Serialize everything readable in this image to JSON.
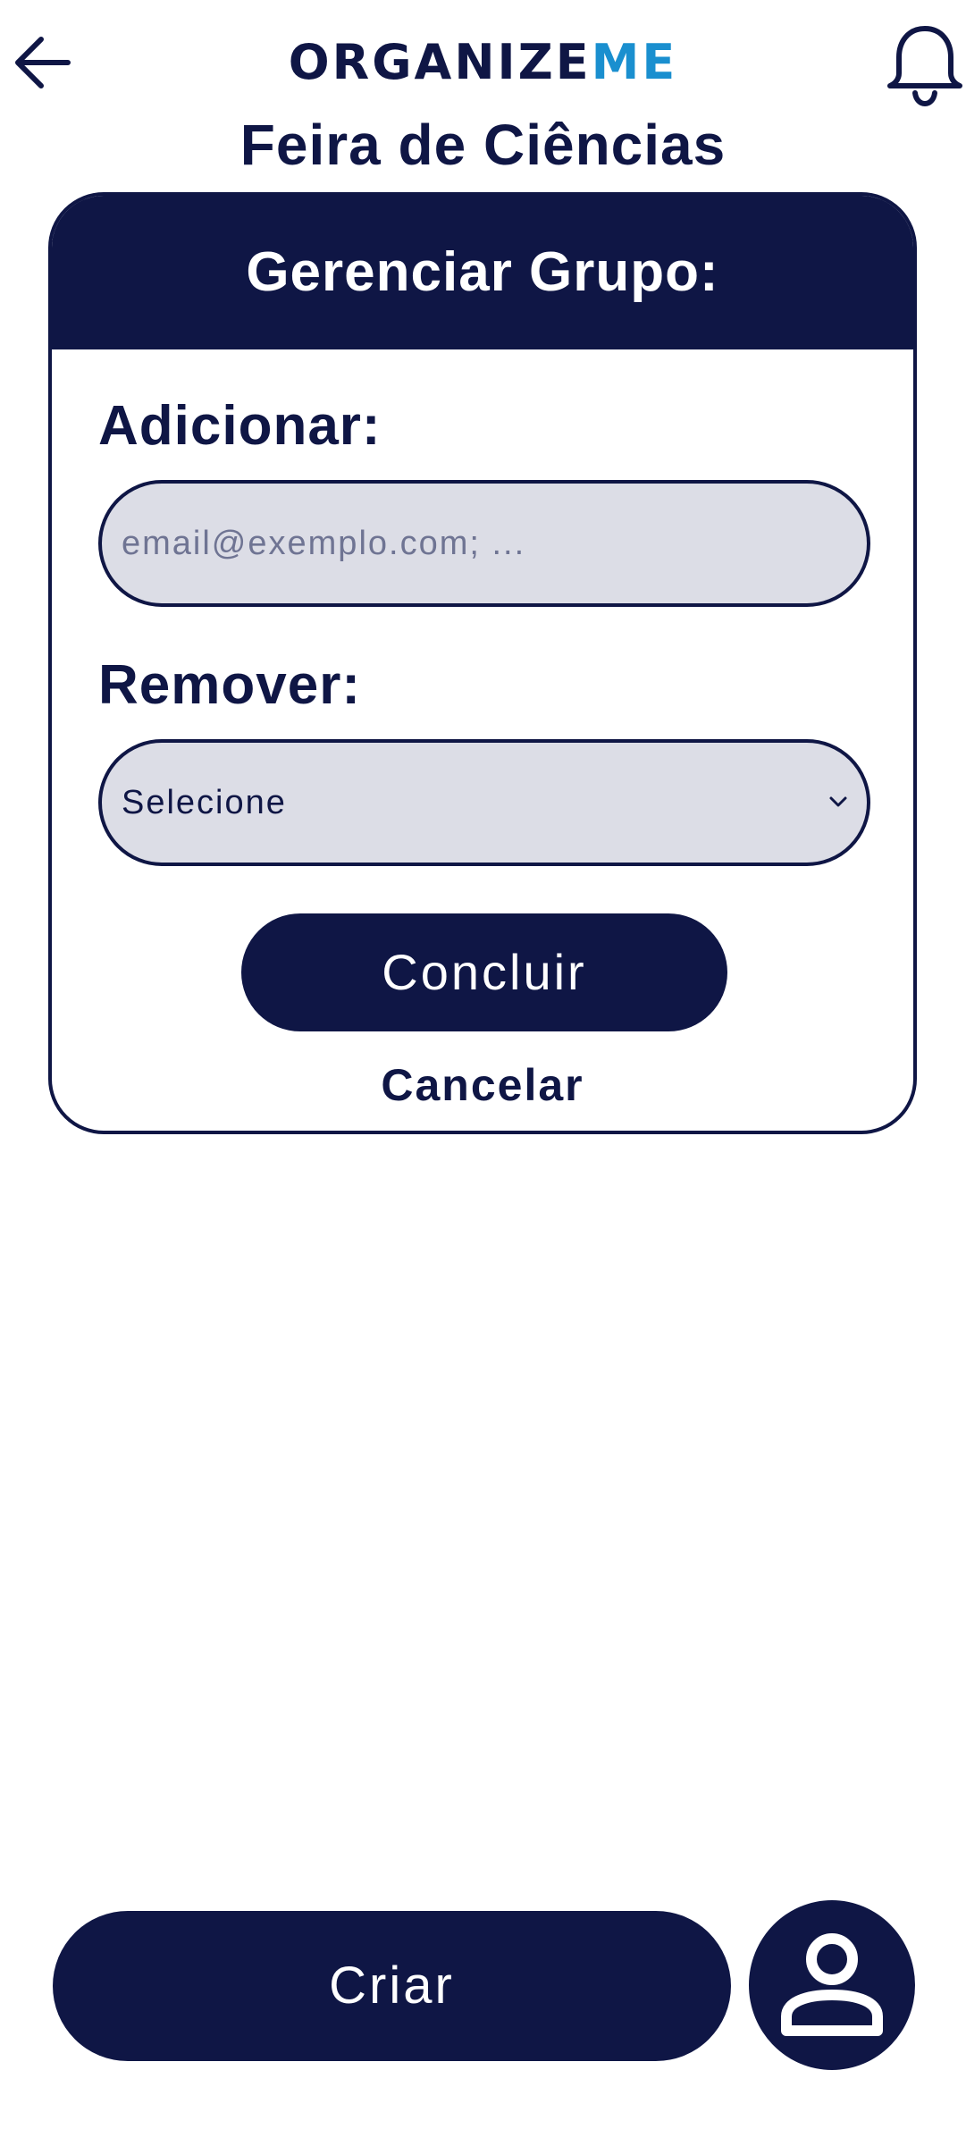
{
  "header": {
    "logo": {
      "main": "ORGANIZE",
      "accent": "ME",
      "accent_color": "#1a8fcf",
      "main_color": "#0f1645"
    },
    "back_icon": "arrow-left-icon",
    "notification_icon": "bell-icon"
  },
  "page": {
    "title": "Feira de Ciências"
  },
  "manage_group": {
    "title": "Gerenciar Grupo:",
    "add_label": "Adicionar:",
    "add_placeholder": "email@exemplo.com; ...",
    "add_value": "",
    "remove_label": "Remover:",
    "remove_selected": "Selecione",
    "conclude_label": "Concluir",
    "cancel_label": "Cancelar"
  },
  "footer": {
    "create_label": "Criar",
    "profile_icon": "user-icon"
  },
  "colors": {
    "primary": "#0f1645",
    "field_background": "#dcdde6",
    "placeholder": "#6f7493",
    "background": "#ffffff"
  }
}
